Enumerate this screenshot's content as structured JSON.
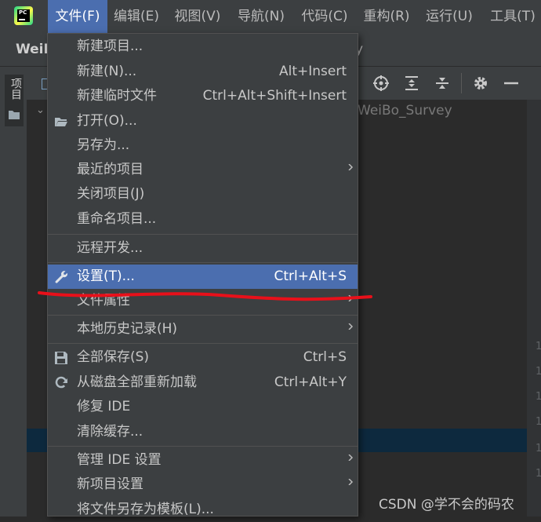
{
  "menubar": {
    "app_icon_text": "PC",
    "items": [
      {
        "label": "文件(F)"
      },
      {
        "label": "编辑(E)"
      },
      {
        "label": "视图(V)"
      },
      {
        "label": "导航(N)"
      },
      {
        "label": "代码(C)"
      },
      {
        "label": "重构(R)"
      },
      {
        "label": "运行(U)"
      },
      {
        "label": "工具(T)"
      }
    ]
  },
  "toolbar": {
    "project_title": "WeiB",
    "trailing_text": "y"
  },
  "left_strip": {
    "project_tab_label": "项目"
  },
  "project_panel": {
    "root_path": "WeiBo_Survey",
    "icons": [
      "crosshair-icon",
      "expand-all-icon",
      "collapse-all-icon",
      "gear-icon",
      "minimize-icon"
    ]
  },
  "gutter": {
    "line_marks": [
      "1",
      "1",
      "1",
      "1",
      "1",
      "1"
    ]
  },
  "file_menu": {
    "items": [
      {
        "label": "新建项目..."
      },
      {
        "label": "新建(N)...",
        "shortcut": "Alt+Insert"
      },
      {
        "label": "新建临时文件",
        "shortcut": "Ctrl+Alt+Shift+Insert"
      },
      {
        "label": "打开(O)...",
        "icon": "folder-open-icon"
      },
      {
        "label": "另存为..."
      },
      {
        "label": "最近的项目",
        "submenu": true
      },
      {
        "label": "关闭项目(J)"
      },
      {
        "label": "重命名项目..."
      },
      {
        "label": "远程开发..."
      },
      {
        "label": "设置(T)...",
        "shortcut": "Ctrl+Alt+S",
        "icon": "wrench-icon",
        "selected": true
      },
      {
        "label": "文件属性",
        "submenu": true
      },
      {
        "label": "本地历史记录(H)",
        "submenu": true
      },
      {
        "label": "全部保存(S)",
        "shortcut": "Ctrl+S",
        "icon": "save-icon"
      },
      {
        "label": "从磁盘全部重新加载",
        "shortcut": "Ctrl+Alt+Y",
        "icon": "reload-icon"
      },
      {
        "label": "修复 IDE"
      },
      {
        "label": "清除缓存..."
      },
      {
        "label": "管理 IDE 设置",
        "submenu": true
      },
      {
        "label": "新项目设置",
        "submenu": true
      },
      {
        "label": "将文件另存为模板(L)..."
      }
    ]
  },
  "annotation": {
    "color": "#e8101a"
  },
  "watermark": {
    "text": "CSDN @学不会的码农"
  },
  "colors": {
    "selection": "#4b6eaf",
    "menu_bg": "#3c3f41",
    "editor_bg": "#2b2b2b"
  }
}
